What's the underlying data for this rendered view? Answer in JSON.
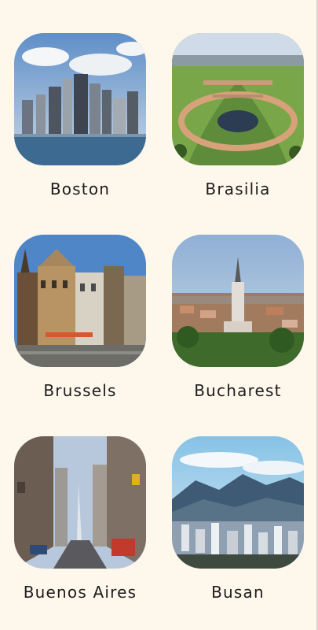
{
  "cities": [
    {
      "name": "Boston",
      "image": "boston-skyline-photo"
    },
    {
      "name": "Brasilia",
      "image": "brasilia-plaza-photo"
    },
    {
      "name": "Brussels",
      "image": "brussels-guildhalls-photo"
    },
    {
      "name": "Bucharest",
      "image": "bucharest-church-photo"
    },
    {
      "name": "Buenos Aires",
      "image": "buenos-aires-avenue-photo"
    },
    {
      "name": "Busan",
      "image": "busan-mountains-photo"
    }
  ]
}
